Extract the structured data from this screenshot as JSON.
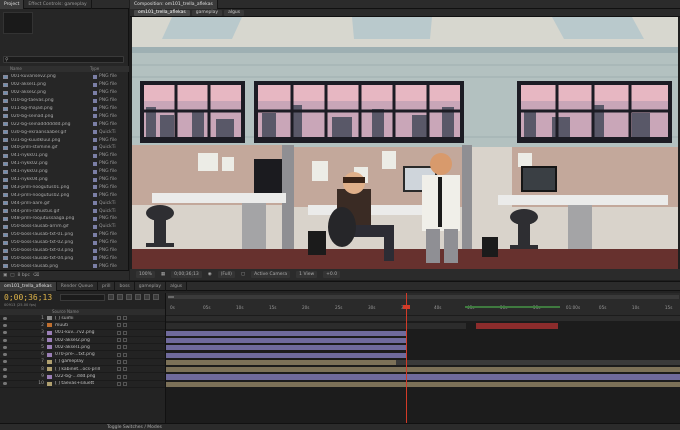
{
  "project": {
    "tabs": [
      "Project",
      "Effect Controls: gameplay"
    ],
    "search_placeholder": "⚲",
    "col_name": "Name",
    "col_type": "Type",
    "files": [
      {
        "name": "001-kuvarisev2.png",
        "type": "PNG file"
      },
      {
        "name": "002-aksel1.png",
        "type": "PNG file"
      },
      {
        "name": "002-aksel2.png",
        "type": "PNG file"
      },
      {
        "name": "010-bg-taevas.png",
        "type": "PNG file"
      },
      {
        "name": "011-bg-majad.png",
        "type": "PNG file"
      },
      {
        "name": "020-bg-seinad.png",
        "type": "PNG file"
      },
      {
        "name": "022-bg-seinaddddddd.png",
        "type": "PNG file"
      },
      {
        "name": "030-bg-ekraansaaber.gif",
        "type": "QuickTi"
      },
      {
        "name": "031-bg-kuudkluul.png",
        "type": "PNG file"
      },
      {
        "name": "040-prilli-stiimine.gif",
        "type": "QuickTi"
      },
      {
        "name": "041-nykk01.png",
        "type": "PNG file"
      },
      {
        "name": "041-nykk02.png",
        "type": "PNG file"
      },
      {
        "name": "041-nykk03.png",
        "type": "PNG file"
      },
      {
        "name": "041-nykk04.png",
        "type": "PNG file"
      },
      {
        "name": "043-prilli-noogutus01.png",
        "type": "PNG file"
      },
      {
        "name": "043-prilli-noogutus02.png",
        "type": "PNG file"
      },
      {
        "name": "044-prilli-aare.gif",
        "type": "QuickTi"
      },
      {
        "name": "044-prilli-rahustus.gif",
        "type": "QuickTi"
      },
      {
        "name": "048-prilli-rööjutussaaga.png",
        "type": "PNG file"
      },
      {
        "name": "050-boss-lausab-arrim.gif",
        "type": "QuickTi"
      },
      {
        "name": "050-boss-lausab-txt-01.png",
        "type": "PNG file"
      },
      {
        "name": "050-boss-lausab-txt-02.png",
        "type": "PNG file"
      },
      {
        "name": "050-boss-lausab-txt-03.png",
        "type": "PNG file"
      },
      {
        "name": "050-boss-lausab-txt-04.png",
        "type": "PNG file"
      },
      {
        "name": "050-boss-lausab.png",
        "type": "PNG file"
      }
    ],
    "footer_bpc": "8 bpc"
  },
  "comp": {
    "tab": "Composition: om101_trella_aflekas",
    "crumbs": [
      "om101_trella_aflekas",
      "gameplay",
      "algus"
    ],
    "footer": {
      "zoom": "100%",
      "timecode": "0;00;36;13",
      "resolution": "(Full)",
      "camera": "Active Camera",
      "view": "1 View",
      "exposure": "+0.0"
    }
  },
  "timeline": {
    "tabs": [
      "om101_trella_aflekas",
      "Render Queue",
      "prill",
      "boss",
      "gameplay",
      "algus"
    ],
    "timecode": "0;00;36;13",
    "timecode_sub": "00913 (25.00 fps)",
    "col_header": "Source Name",
    "ruler_ticks": [
      "0s",
      "05s",
      "10s",
      "15s",
      "20s",
      "25s",
      "30s",
      "35s",
      "40s",
      "45s",
      "50s",
      "55s",
      "01:00s",
      "05s",
      "10s",
      "15s"
    ],
    "layers": [
      {
        "num": "1",
        "name": "[ ] suimi",
        "color": "#8a8a8a"
      },
      {
        "num": "2",
        "name": "muuti",
        "color": "#c07030"
      },
      {
        "num": "3",
        "name": "001-kuv...rv2.png",
        "color": "#9b7fb7"
      },
      {
        "num": "4",
        "name": "002-aksel2.png",
        "color": "#9b7fb7"
      },
      {
        "num": "5",
        "name": "002-aksel1.png",
        "color": "#9b7fb7"
      },
      {
        "num": "6",
        "name": "070-pre-...txt.png",
        "color": "#9b7fb7"
      },
      {
        "num": "7",
        "name": "[ ] gameplay",
        "color": "#b0a070"
      },
      {
        "num": "8",
        "name": "[ ] kabinet...ocs-prill",
        "color": "#b0a070"
      },
      {
        "num": "9",
        "name": "022-bg-...ddd.png",
        "color": "#9b7fb7"
      },
      {
        "num": "10",
        "name": "[ ] taevas+siluett",
        "color": "#b0a070"
      }
    ],
    "footer": "Toggle Switches / Modes"
  },
  "colors": {
    "timecode": "#e0b54a",
    "playhead": "#d23b28",
    "bar_purple": "#6f6a9c",
    "bar_tan": "#7c7158",
    "bar_red": "#8c2c2c",
    "bar_green": "#3f7a3f"
  }
}
